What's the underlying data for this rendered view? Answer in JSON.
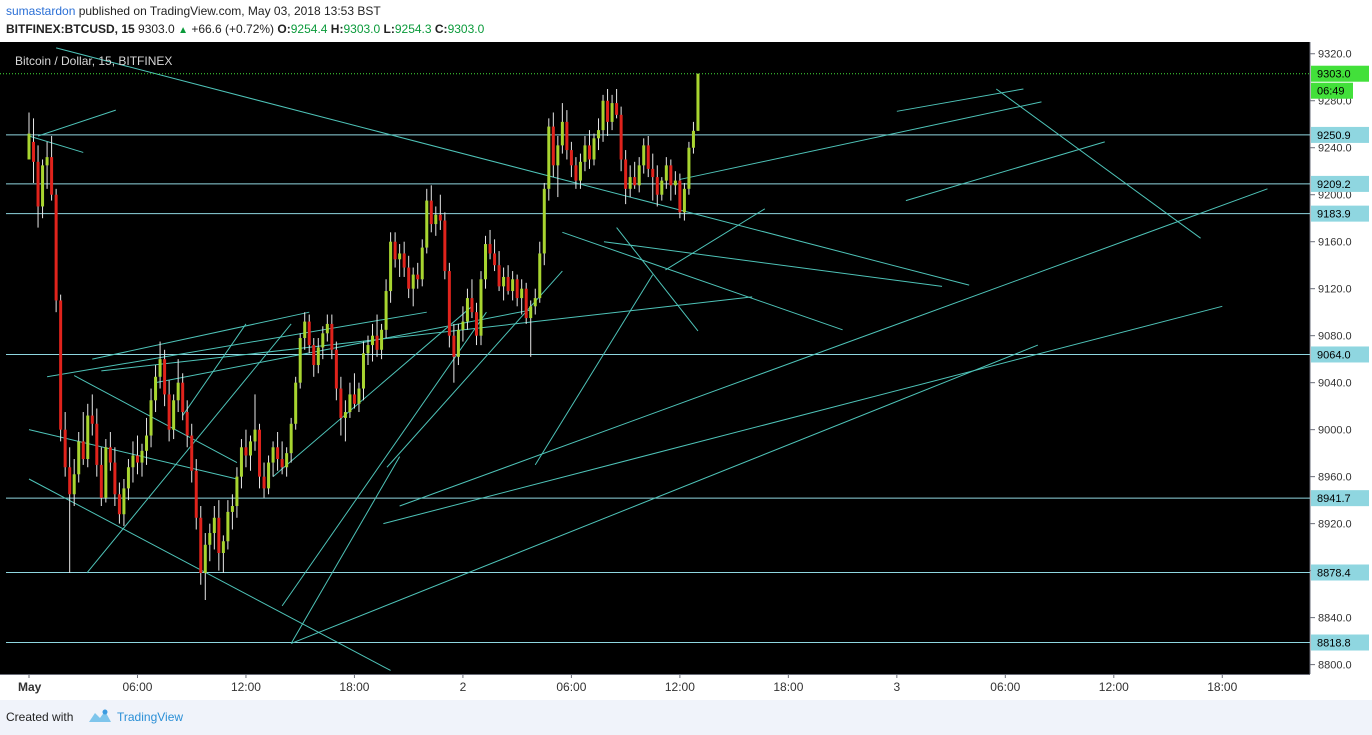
{
  "header": {
    "author": "sumastardon",
    "published": " published on TradingView.com, May 03, 2018 13:53 BST",
    "symbol": "BITFINEX:BTCUSD, 15",
    "last": "9303.0",
    "change": "+66.6 (+0.72%)",
    "o_label": "O:",
    "o_value": "9254.4",
    "h_label": "H:",
    "h_value": "9303.0",
    "l_label": "L:",
    "l_value": "9254.3",
    "c_label": "C:",
    "c_value": "9303.0"
  },
  "footer": {
    "created": "Created with",
    "brand": "TradingView"
  },
  "chart_data": {
    "type": "candlestick",
    "title": "Bitcoin / Dollar, 15, BITFINEX",
    "ylim": [
      8792,
      9330
    ],
    "y_ticks": [
      8800,
      8840,
      8880,
      8920,
      8960,
      9000,
      9040,
      9080,
      9120,
      9160,
      9200,
      9240,
      9280,
      9320
    ],
    "y_tick_labels": [
      "8800.0",
      "8840.0",
      "8880.0",
      "8920.0",
      "8960.0",
      "9000.0",
      "9040.0",
      "9080.0",
      "9120.0",
      "9160.0",
      "9200.0",
      "9240.0",
      "9280.0",
      "9320.0"
    ],
    "x_range": [
      0,
      48
    ],
    "x_ticks": [
      0,
      6,
      12,
      18,
      24,
      30,
      36,
      42,
      48,
      54,
      60,
      66
    ],
    "x_tick_labels": [
      "May",
      "06:00",
      "12:00",
      "18:00",
      "2",
      "06:00",
      "12:00",
      "18:00",
      "3",
      "06:00",
      "12:00",
      "18:00"
    ],
    "horizontal_levels": [
      9250.9,
      9209.2,
      9183.9,
      9064.0,
      8941.7,
      8878.4,
      8818.8
    ],
    "horizontal_level_labels": [
      "9250.9",
      "9209.2",
      "9183.9",
      "9064.0",
      "8941.7",
      "8878.4",
      "8818.8"
    ],
    "last_price": 9303.0,
    "last_price_label": "9303.0",
    "countdown": "06:49",
    "colors": {
      "up": "#a8d530",
      "down": "#e0231c",
      "lines": "#4ec3b8",
      "levels": "#8fd6e0",
      "last": "#42e03a"
    },
    "trendlines": [
      [
        0.5,
        9250,
        4.8,
        9272
      ],
      [
        0,
        9250,
        3,
        9236
      ],
      [
        1.5,
        9325,
        52,
        9123
      ],
      [
        0,
        9000,
        11.5,
        8958
      ],
      [
        0,
        8958,
        20,
        8795
      ],
      [
        2.5,
        9046,
        11.5,
        8972
      ],
      [
        3.2,
        8878,
        14.5,
        9090
      ],
      [
        8.5,
        9012,
        12,
        9090
      ],
      [
        1,
        9045,
        22,
        9100
      ],
      [
        4,
        9050,
        40,
        9113
      ],
      [
        7,
        9040,
        27.8,
        9102
      ],
      [
        14.5,
        8818,
        55.8,
        9072
      ],
      [
        14.5,
        8818,
        20.5,
        8977
      ],
      [
        14,
        8850,
        25.3,
        9100
      ],
      [
        13.5,
        8960,
        24.5,
        9105
      ],
      [
        19.8,
        8968,
        29.5,
        9135
      ],
      [
        28,
        8970,
        34.5,
        9132
      ],
      [
        20.5,
        8935,
        68.5,
        9205
      ],
      [
        19.6,
        8920,
        66,
        9105
      ],
      [
        32.5,
        9172,
        37,
        9084
      ],
      [
        35.2,
        9136,
        40.7,
        9188
      ],
      [
        31.8,
        9160,
        50.5,
        9122
      ],
      [
        36,
        9213,
        56,
        9279
      ],
      [
        48,
        9271,
        55,
        9290
      ],
      [
        48.5,
        9195,
        59.5,
        9245
      ],
      [
        53.5,
        9290,
        64.8,
        9163
      ],
      [
        45,
        9085,
        29.5,
        9168
      ],
      [
        3.5,
        9060,
        15.5,
        9100
      ]
    ],
    "candles": [
      [
        9230,
        9270,
        9240,
        9252
      ],
      [
        9245,
        9265,
        9210,
        9228
      ],
      [
        9228,
        9242,
        9172,
        9190
      ],
      [
        9190,
        9230,
        9180,
        9225
      ],
      [
        9225,
        9245,
        9205,
        9232
      ],
      [
        9232,
        9250,
        9195,
        9200
      ],
      [
        9200,
        9205,
        9100,
        9110
      ],
      [
        9110,
        9115,
        8990,
        9000
      ],
      [
        9000,
        9015,
        8960,
        8968
      ],
      [
        8968,
        8985,
        8878,
        8945
      ],
      [
        8945,
        8975,
        8935,
        8962
      ],
      [
        8962,
        8998,
        8955,
        8990
      ],
      [
        8990,
        9015,
        8970,
        8975
      ],
      [
        8975,
        9022,
        8968,
        9012
      ],
      [
        9012,
        9030,
        8995,
        9005
      ],
      [
        9005,
        9018,
        8960,
        8970
      ],
      [
        8970,
        8985,
        8935,
        8942
      ],
      [
        8942,
        8992,
        8938,
        8985
      ],
      [
        8985,
        8998,
        8965,
        8972
      ],
      [
        8972,
        8985,
        8935,
        8945
      ],
      [
        8945,
        8955,
        8920,
        8928
      ],
      [
        8928,
        8958,
        8918,
        8950
      ],
      [
        8950,
        8975,
        8940,
        8968
      ],
      [
        8968,
        8990,
        8955,
        8978
      ],
      [
        8978,
        8995,
        8962,
        8972
      ],
      [
        8972,
        8988,
        8960,
        8982
      ],
      [
        8982,
        9010,
        8970,
        8995
      ],
      [
        8995,
        9035,
        8985,
        9025
      ],
      [
        9025,
        9055,
        9015,
        9045
      ],
      [
        9045,
        9075,
        9035,
        9060
      ],
      [
        9060,
        9068,
        9020,
        9030
      ],
      [
        9030,
        9042,
        8990,
        9000
      ],
      [
        9000,
        9030,
        8992,
        9025
      ],
      [
        9025,
        9060,
        9015,
        9040
      ],
      [
        9040,
        9048,
        9008,
        9015
      ],
      [
        9015,
        9025,
        8985,
        8995
      ],
      [
        8995,
        9005,
        8955,
        8965
      ],
      [
        8965,
        8975,
        8915,
        8925
      ],
      [
        8925,
        8935,
        8868,
        8878
      ],
      [
        8878,
        8912,
        8855,
        8902
      ],
      [
        8902,
        8920,
        8888,
        8912
      ],
      [
        8912,
        8935,
        8898,
        8925
      ],
      [
        8925,
        8940,
        8880,
        8895
      ],
      [
        8895,
        8910,
        8878,
        8905
      ],
      [
        8905,
        8940,
        8898,
        8930
      ],
      [
        8930,
        8945,
        8915,
        8935
      ],
      [
        8935,
        8968,
        8925,
        8960
      ],
      [
        8960,
        8992,
        8950,
        8985
      ],
      [
        8985,
        9000,
        8968,
        8978
      ],
      [
        8978,
        8995,
        8965,
        8990
      ],
      [
        8990,
        9030,
        8982,
        9000
      ],
      [
        9000,
        9005,
        8950,
        8960
      ],
      [
        8960,
        8972,
        8942,
        8950
      ],
      [
        8950,
        8978,
        8945,
        8972
      ],
      [
        8972,
        8990,
        8960,
        8985
      ],
      [
        8985,
        8998,
        8965,
        8975
      ],
      [
        8975,
        8990,
        8962,
        8968
      ],
      [
        8968,
        8985,
        8960,
        8980
      ],
      [
        8980,
        9010,
        8972,
        9005
      ],
      [
        9005,
        9045,
        9000,
        9040
      ],
      [
        9040,
        9082,
        9035,
        9078
      ],
      [
        9078,
        9100,
        9068,
        9092
      ],
      [
        9092,
        9098,
        9065,
        9072
      ],
      [
        9072,
        9078,
        9045,
        9055
      ],
      [
        9055,
        9078,
        9048,
        9070
      ],
      [
        9070,
        9088,
        9060,
        9082
      ],
      [
        9082,
        9098,
        9075,
        9090
      ],
      [
        9090,
        9098,
        9060,
        9068
      ],
      [
        9068,
        9075,
        9025,
        9035
      ],
      [
        9035,
        9045,
        8995,
        9010
      ],
      [
        9010,
        9025,
        8990,
        9015
      ],
      [
        9015,
        9040,
        9010,
        9030
      ],
      [
        9030,
        9048,
        9018,
        9022
      ],
      [
        9022,
        9040,
        9015,
        9035
      ],
      [
        9035,
        9075,
        9025,
        9065
      ],
      [
        9065,
        9080,
        9055,
        9072
      ],
      [
        9072,
        9090,
        9058,
        9080
      ],
      [
        9080,
        9098,
        9062,
        9068
      ],
      [
        9068,
        9090,
        9060,
        9085
      ],
      [
        9085,
        9128,
        9078,
        9118
      ],
      [
        9118,
        9168,
        9108,
        9160
      ],
      [
        9160,
        9168,
        9138,
        9145
      ],
      [
        9145,
        9158,
        9130,
        9150
      ],
      [
        9150,
        9160,
        9130,
        9138
      ],
      [
        9138,
        9148,
        9112,
        9120
      ],
      [
        9120,
        9138,
        9105,
        9132
      ],
      [
        9132,
        9142,
        9120,
        9128
      ],
      [
        9128,
        9162,
        9122,
        9155
      ],
      [
        9155,
        9205,
        9150,
        9195
      ],
      [
        9195,
        9208,
        9168,
        9175
      ],
      [
        9175,
        9190,
        9165,
        9183
      ],
      [
        9183,
        9200,
        9170,
        9178
      ],
      [
        9178,
        9185,
        9128,
        9135
      ],
      [
        9135,
        9142,
        9070,
        9080
      ],
      [
        9080,
        9090,
        9040,
        9062
      ],
      [
        9062,
        9090,
        9055,
        9085
      ],
      [
        9085,
        9105,
        9075,
        9092
      ],
      [
        9092,
        9120,
        9085,
        9112
      ],
      [
        9112,
        9128,
        9095,
        9100
      ],
      [
        9100,
        9108,
        9072,
        9080
      ],
      [
        9080,
        9135,
        9072,
        9128
      ],
      [
        9128,
        9165,
        9120,
        9158
      ],
      [
        9158,
        9170,
        9145,
        9150
      ],
      [
        9150,
        9162,
        9135,
        9140
      ],
      [
        9140,
        9152,
        9118,
        9122
      ],
      [
        9122,
        9138,
        9110,
        9130
      ],
      [
        9130,
        9140,
        9115,
        9118
      ],
      [
        9118,
        9135,
        9110,
        9128
      ],
      [
        9128,
        9132,
        9105,
        9112
      ],
      [
        9112,
        9128,
        9098,
        9120
      ],
      [
        9120,
        9125,
        9090,
        9095
      ],
      [
        9095,
        9110,
        9062,
        9105
      ],
      [
        9105,
        9120,
        9098,
        9112
      ],
      [
        9112,
        9160,
        9108,
        9150
      ],
      [
        9150,
        9210,
        9140,
        9205
      ],
      [
        9205,
        9265,
        9195,
        9258
      ],
      [
        9258,
        9270,
        9215,
        9225
      ],
      [
        9225,
        9250,
        9198,
        9242
      ],
      [
        9242,
        9278,
        9235,
        9262
      ],
      [
        9262,
        9272,
        9230,
        9238
      ],
      [
        9238,
        9245,
        9215,
        9225
      ],
      [
        9225,
        9232,
        9205,
        9212
      ],
      [
        9212,
        9235,
        9205,
        9228
      ],
      [
        9228,
        9250,
        9220,
        9242
      ],
      [
        9242,
        9255,
        9222,
        9230
      ],
      [
        9230,
        9252,
        9225,
        9248
      ],
      [
        9248,
        9265,
        9238,
        9255
      ],
      [
        9255,
        9285,
        9245,
        9280
      ],
      [
        9280,
        9290,
        9250,
        9262
      ],
      [
        9262,
        9285,
        9255,
        9278
      ],
      [
        9278,
        9290,
        9265,
        9268
      ],
      [
        9268,
        9275,
        9220,
        9230
      ],
      [
        9230,
        9238,
        9192,
        9205
      ],
      [
        9205,
        9225,
        9198,
        9215
      ],
      [
        9215,
        9228,
        9205,
        9208
      ],
      [
        9208,
        9232,
        9202,
        9225
      ],
      [
        9225,
        9248,
        9218,
        9242
      ],
      [
        9242,
        9250,
        9215,
        9222
      ],
      [
        9222,
        9235,
        9195,
        9215
      ],
      [
        9215,
        9225,
        9190,
        9200
      ],
      [
        9200,
        9215,
        9195,
        9212
      ],
      [
        9212,
        9232,
        9205,
        9225
      ],
      [
        9225,
        9230,
        9195,
        9208
      ],
      [
        9208,
        9220,
        9200,
        9212
      ],
      [
        9212,
        9218,
        9180,
        9185
      ],
      [
        9185,
        9210,
        9178,
        9205
      ],
      [
        9205,
        9245,
        9200,
        9240
      ],
      [
        9240,
        9262,
        9235,
        9254.4
      ],
      [
        9254.4,
        9303,
        9254.3,
        9303
      ]
    ]
  }
}
